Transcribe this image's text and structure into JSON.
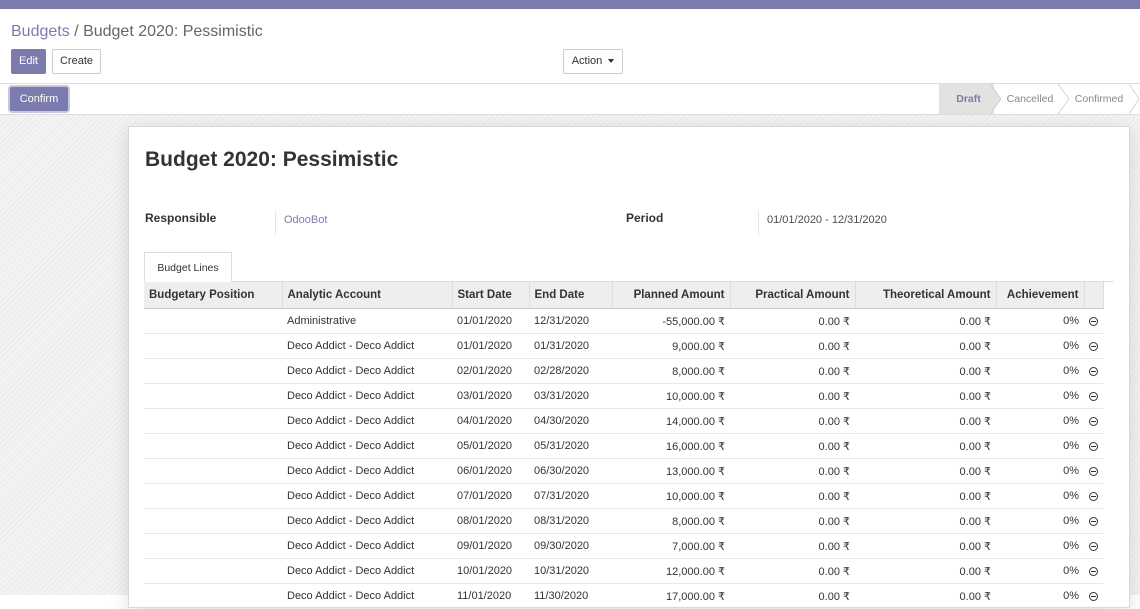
{
  "breadcrumb": {
    "parent": "Budgets",
    "separator": " / ",
    "current": "Budget 2020: Pessimistic"
  },
  "toolbar": {
    "edit_label": "Edit",
    "create_label": "Create",
    "action_label": "Action"
  },
  "statusbar": {
    "confirm_label": "Confirm",
    "stages": [
      "Draft",
      "Cancelled",
      "Confirmed"
    ],
    "active_stage": "Draft"
  },
  "form": {
    "title": "Budget 2020: Pessimistic",
    "responsible_label": "Responsible",
    "responsible_value": "OdooBot",
    "period_label": "Period",
    "period_value": "01/01/2020 - 12/31/2020"
  },
  "tab": {
    "label": "Budget Lines"
  },
  "table": {
    "columns": [
      "Budgetary Position",
      "Analytic Account",
      "Start Date",
      "End Date",
      "Planned Amount",
      "Practical Amount",
      "Theoretical Amount",
      "Achievement"
    ],
    "rows": [
      [
        "",
        "Administrative",
        "01/01/2020",
        "12/31/2020",
        "-55,000.00 ₹",
        "0.00 ₹",
        "0.00 ₹",
        "0%"
      ],
      [
        "",
        "Deco Addict - Deco Addict",
        "01/01/2020",
        "01/31/2020",
        "9,000.00 ₹",
        "0.00 ₹",
        "0.00 ₹",
        "0%"
      ],
      [
        "",
        "Deco Addict - Deco Addict",
        "02/01/2020",
        "02/28/2020",
        "8,000.00 ₹",
        "0.00 ₹",
        "0.00 ₹",
        "0%"
      ],
      [
        "",
        "Deco Addict - Deco Addict",
        "03/01/2020",
        "03/31/2020",
        "10,000.00 ₹",
        "0.00 ₹",
        "0.00 ₹",
        "0%"
      ],
      [
        "",
        "Deco Addict - Deco Addict",
        "04/01/2020",
        "04/30/2020",
        "14,000.00 ₹",
        "0.00 ₹",
        "0.00 ₹",
        "0%"
      ],
      [
        "",
        "Deco Addict - Deco Addict",
        "05/01/2020",
        "05/31/2020",
        "16,000.00 ₹",
        "0.00 ₹",
        "0.00 ₹",
        "0%"
      ],
      [
        "",
        "Deco Addict - Deco Addict",
        "06/01/2020",
        "06/30/2020",
        "13,000.00 ₹",
        "0.00 ₹",
        "0.00 ₹",
        "0%"
      ],
      [
        "",
        "Deco Addict - Deco Addict",
        "07/01/2020",
        "07/31/2020",
        "10,000.00 ₹",
        "0.00 ₹",
        "0.00 ₹",
        "0%"
      ],
      [
        "",
        "Deco Addict - Deco Addict",
        "08/01/2020",
        "08/31/2020",
        "8,000.00 ₹",
        "0.00 ₹",
        "0.00 ₹",
        "0%"
      ],
      [
        "",
        "Deco Addict - Deco Addict",
        "09/01/2020",
        "09/30/2020",
        "7,000.00 ₹",
        "0.00 ₹",
        "0.00 ₹",
        "0%"
      ],
      [
        "",
        "Deco Addict - Deco Addict",
        "10/01/2020",
        "10/31/2020",
        "12,000.00 ₹",
        "0.00 ₹",
        "0.00 ₹",
        "0%"
      ],
      [
        "",
        "Deco Addict - Deco Addict",
        "11/01/2020",
        "11/30/2020",
        "17,000.00 ₹",
        "0.00 ₹",
        "0.00 ₹",
        "0%"
      ]
    ]
  },
  "colors": {
    "brand": "#7c7bad",
    "active_stage_bg": "#e2e2e0"
  },
  "icons": {
    "row_action": "minus-circle-icon"
  }
}
